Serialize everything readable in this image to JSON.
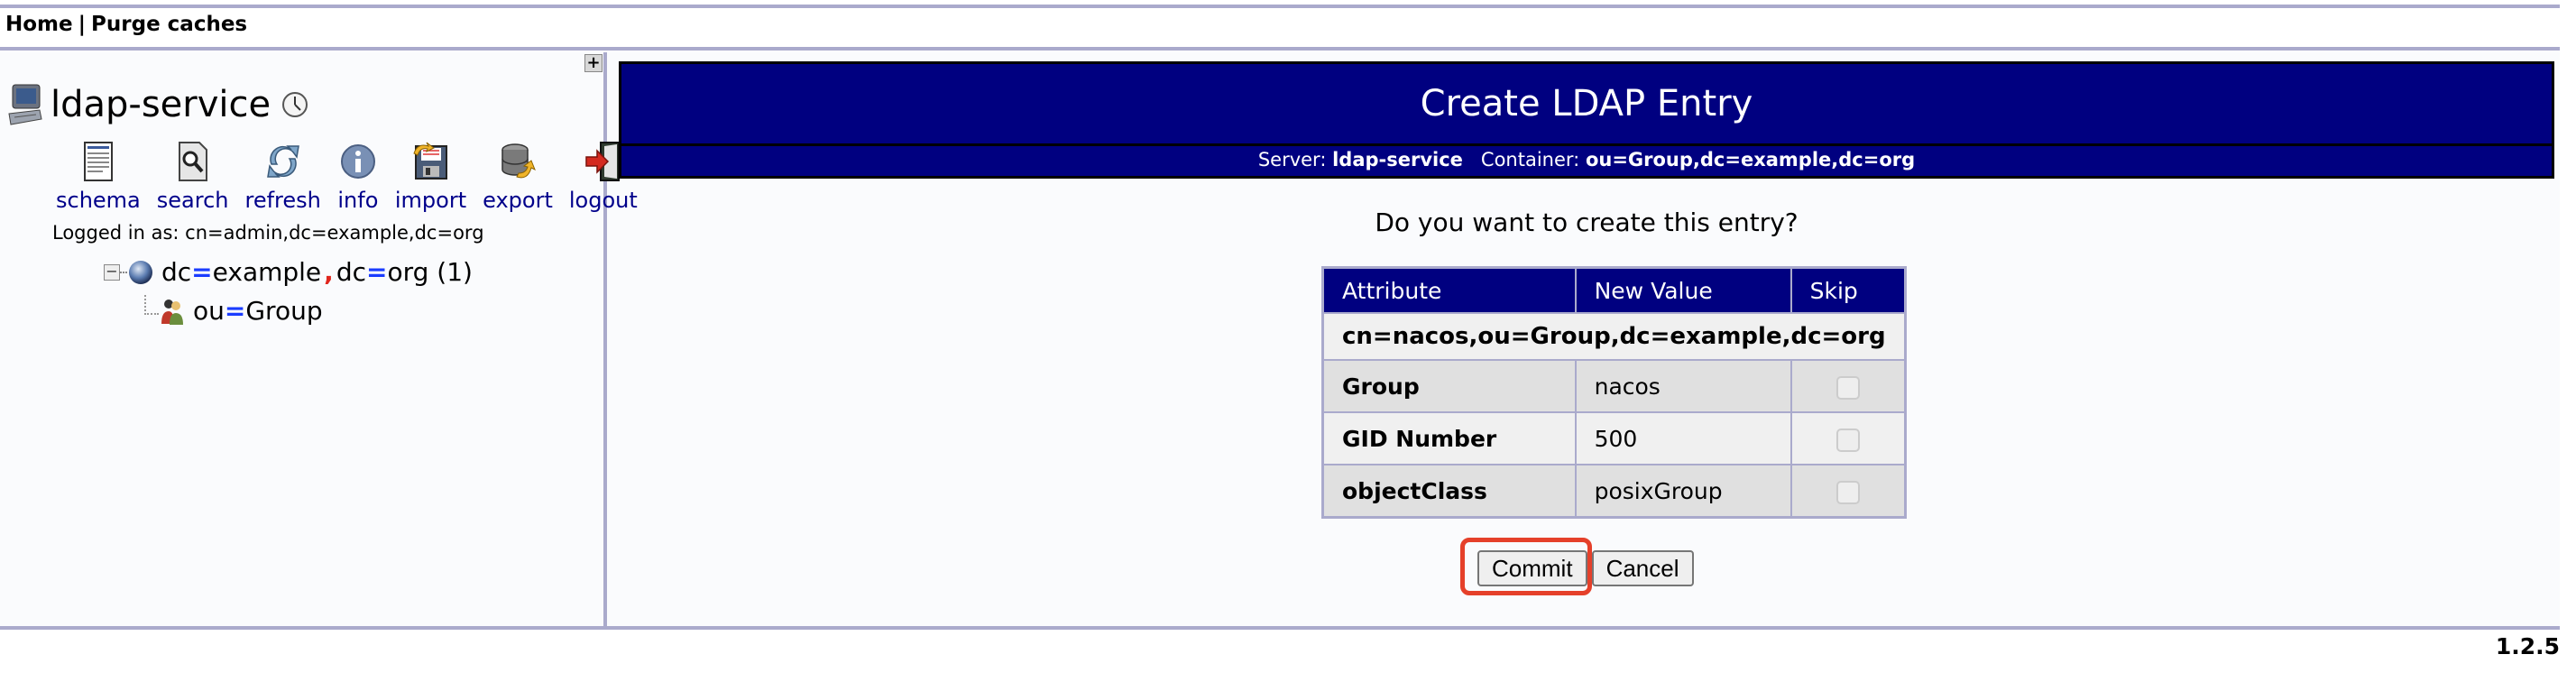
{
  "topnav": {
    "home": "Home",
    "separator": "|",
    "purge": "Purge caches"
  },
  "sidebar": {
    "expand_label": "+",
    "server_name": "ldap-service",
    "tools": [
      {
        "label": "schema",
        "icon": "schema-icon"
      },
      {
        "label": "search",
        "icon": "search-icon"
      },
      {
        "label": "refresh",
        "icon": "refresh-icon"
      },
      {
        "label": "info",
        "icon": "info-icon"
      },
      {
        "label": "import",
        "icon": "import-icon"
      },
      {
        "label": "export",
        "icon": "export-icon"
      },
      {
        "label": "logout",
        "icon": "logout-icon"
      }
    ],
    "logged_in": "Logged in as: cn=admin,dc=example,dc=org",
    "tree": {
      "root": {
        "expander": "−",
        "part1_key": "dc",
        "part1_val": "example",
        "part2_key": "dc",
        "part2_val": "org",
        "count": "(1)"
      },
      "child": {
        "key": "ou",
        "val": "Group"
      }
    }
  },
  "main": {
    "title": "Create LDAP Entry",
    "server_label": "Server:",
    "server_value": "ldap-service",
    "container_label": "Container:",
    "container_value": "ou=Group,dc=example,dc=org",
    "question": "Do you want to create this entry?",
    "table": {
      "headers": [
        "Attribute",
        "New Value",
        "Skip"
      ],
      "dn": "cn=nacos,ou=Group,dc=example,dc=org",
      "rows": [
        {
          "attribute": "Group",
          "value": "nacos",
          "skip": false
        },
        {
          "attribute": "GID Number",
          "value": "500",
          "skip": false
        },
        {
          "attribute": "objectClass",
          "value": "posixGroup",
          "skip": false
        }
      ]
    },
    "buttons": {
      "commit": "Commit",
      "cancel": "Cancel"
    }
  },
  "footer": {
    "version": "1.2.5"
  },
  "colors": {
    "header_bg": "#000080",
    "link": "#00008b",
    "border": "#aaaacc",
    "highlight": "#e5402a"
  }
}
